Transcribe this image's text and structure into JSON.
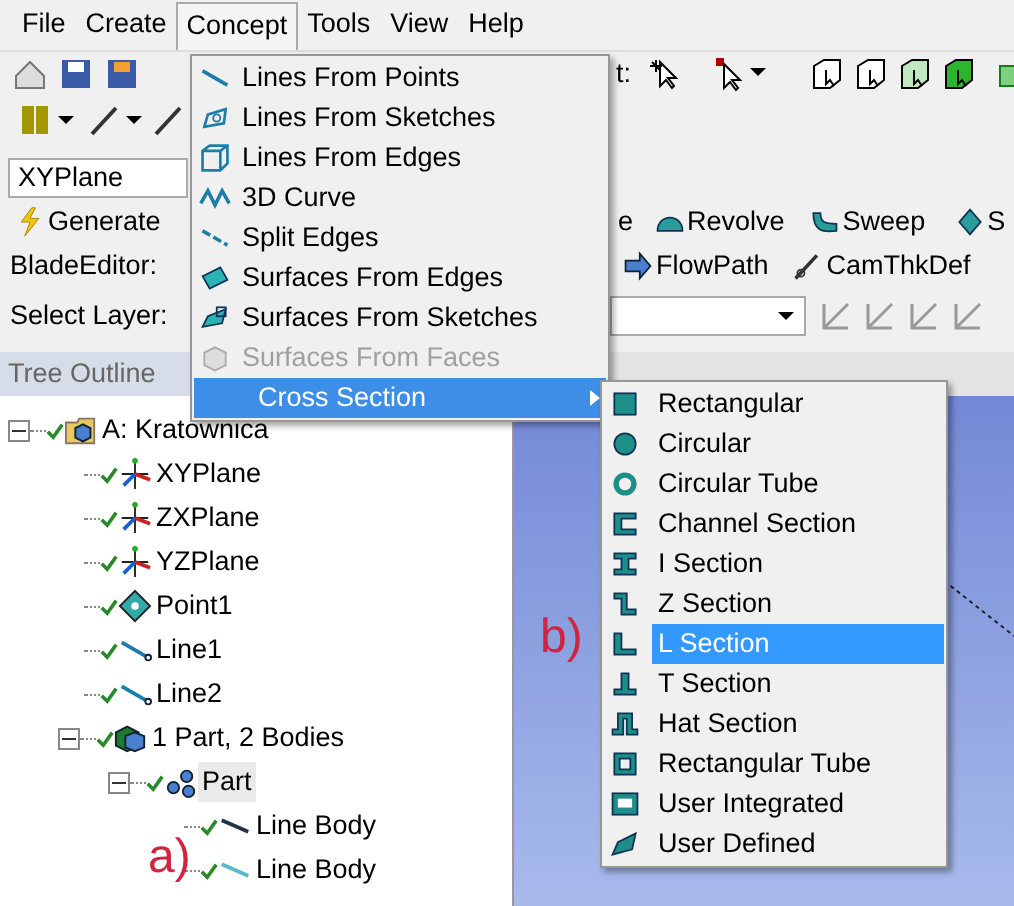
{
  "menubar": [
    {
      "label": "File",
      "selected": false
    },
    {
      "label": "Create",
      "selected": false
    },
    {
      "label": "Concept",
      "selected": true
    },
    {
      "label": "Tools",
      "selected": false
    },
    {
      "label": "View",
      "selected": false
    },
    {
      "label": "Help",
      "selected": false
    }
  ],
  "toolbar": {
    "select_label": "t:"
  },
  "plane_dropdown": {
    "value": "XYPlane"
  },
  "features": [
    {
      "label": "Generate"
    },
    {
      "label": "e"
    },
    {
      "label": "Revolve"
    },
    {
      "label": "Sweep"
    },
    {
      "label": "S"
    }
  ],
  "blade_editor": {
    "label": "BladeEditor:",
    "tools": [
      {
        "label": "FlowPath"
      },
      {
        "label": "CamThkDef"
      }
    ]
  },
  "layer": {
    "label": "Select Layer:"
  },
  "tree_outline": {
    "title": "Tree Outline",
    "items": [
      {
        "label": "A: Kratownica",
        "expanded": true,
        "selected": false,
        "children": [
          {
            "label": "XYPlane",
            "selected": false
          },
          {
            "label": "ZXPlane",
            "selected": false
          },
          {
            "label": "YZPlane",
            "selected": false
          },
          {
            "label": "Point1",
            "selected": false
          },
          {
            "label": "Line1",
            "selected": false
          },
          {
            "label": "Line2",
            "selected": false
          },
          {
            "label": "1 Part, 2 Bodies",
            "expanded": true,
            "selected": false,
            "children": [
              {
                "label": "Part",
                "expanded": true,
                "selected": true,
                "children": [
                  {
                    "label": "Line Body",
                    "selected": false
                  },
                  {
                    "label": "Line Body",
                    "selected": false
                  }
                ]
              }
            ]
          }
        ]
      }
    ]
  },
  "concept_menu": {
    "items": [
      {
        "label": "Lines From Points",
        "disabled": false,
        "selected": false
      },
      {
        "label": "Lines From Sketches",
        "disabled": false,
        "selected": false
      },
      {
        "label": "Lines From Edges",
        "disabled": false,
        "selected": false
      },
      {
        "label": "3D Curve",
        "disabled": false,
        "selected": false
      },
      {
        "label": "Split Edges",
        "disabled": false,
        "selected": false
      },
      {
        "label": "Surfaces From Edges",
        "disabled": false,
        "selected": false
      },
      {
        "label": "Surfaces From Sketches",
        "disabled": false,
        "selected": false
      },
      {
        "label": "Surfaces From Faces",
        "disabled": true,
        "selected": false
      },
      {
        "label": "Cross Section",
        "disabled": false,
        "selected": true,
        "submenu": true
      }
    ]
  },
  "cross_section_menu": {
    "items": [
      {
        "label": "Rectangular",
        "selected": false
      },
      {
        "label": "Circular",
        "selected": false
      },
      {
        "label": "Circular Tube",
        "selected": false
      },
      {
        "label": "Channel Section",
        "selected": false
      },
      {
        "label": "I Section",
        "selected": false
      },
      {
        "label": "Z Section",
        "selected": false
      },
      {
        "label": "L Section",
        "selected": true
      },
      {
        "label": "T Section",
        "selected": false
      },
      {
        "label": "Hat Section",
        "selected": false
      },
      {
        "label": "Rectangular Tube",
        "selected": false
      },
      {
        "label": "User Integrated",
        "selected": false
      },
      {
        "label": "User Defined",
        "selected": false
      }
    ]
  },
  "annotations": [
    {
      "label": "a)"
    },
    {
      "label": "b)"
    }
  ]
}
